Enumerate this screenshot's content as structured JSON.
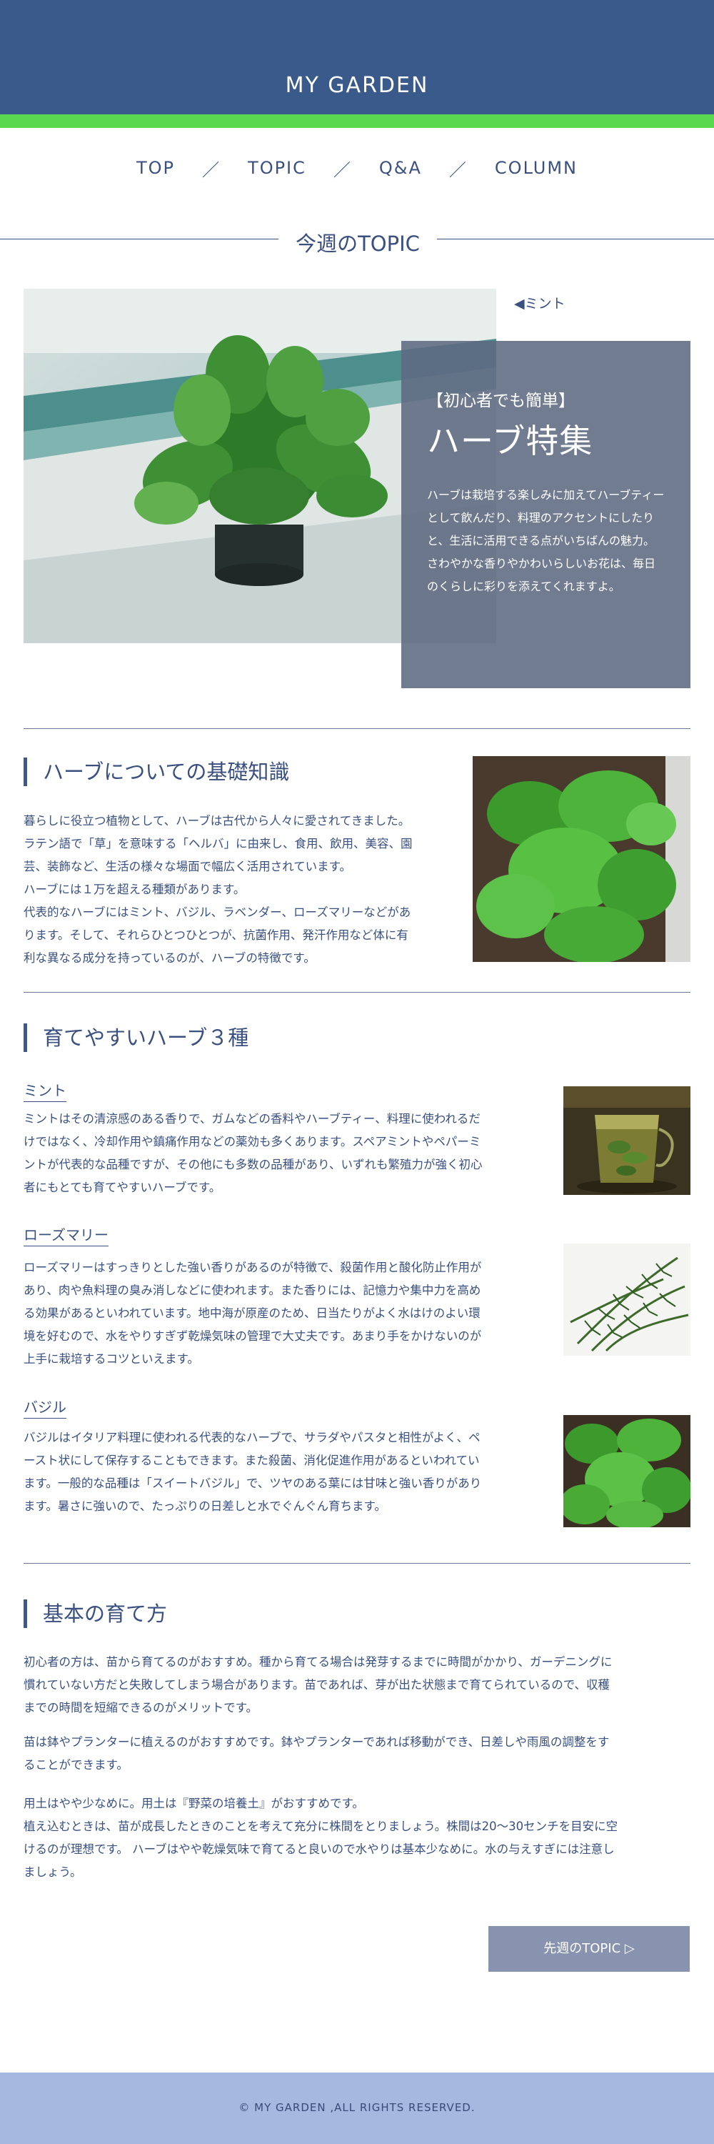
{
  "header": {
    "site_title": "MY GARDEN"
  },
  "nav": {
    "items": [
      {
        "label": "TOP"
      },
      {
        "label": "TOPIC"
      },
      {
        "label": "Q&A"
      },
      {
        "label": "COLUMN"
      }
    ],
    "separator": "／"
  },
  "week": {
    "heading": "今週のTOPIC"
  },
  "hero": {
    "caption": "◀ミント",
    "subtitle": "【初心者でも簡単】",
    "title": "ハーブ特集",
    "body": "ハーブは栽培する楽しみに加えてハーブティーとして飲んだり、料理のアクセントにしたりと、生活に活用できる点がいちばんの魅力。さわやかな香りやかわいらしいお花は、毎日のくらしに彩りを添えてくれますよ。"
  },
  "basics": {
    "title": "ハーブについての基礎知識",
    "lines": [
      "暮らしに役立つ植物として、ハーブは古代から人々に愛されてきました。",
      "ラテン語で「草」を意味する「ヘルバ」に由来し、食用、飲用、美容、園",
      "芸、装飾など、生活の様々な場面で幅広く活用されています。",
      "ハーブには１万を超える種類があります。",
      "代表的なハーブにはミント、バジル、ラベンダー、ローズマリーなどがあ",
      "ります。そして、それらひとつひとつが、抗菌作用、発汗作用など体に有",
      "利な異なる成分を持っているのが、ハーブの特徴です。"
    ]
  },
  "easy": {
    "title": "育てやすいハーブ３種",
    "herbs": [
      {
        "name": "ミント",
        "lines": [
          "ミントはその清涼感のある香りで、ガムなどの香料やハーブティー、料理に使われるだ",
          "けではなく、冷却作用や鎮痛作用などの薬効も多くあります。スペアミントやペパーミ",
          "ントが代表的な品種ですが、その他にも多数の品種があり、いずれも繁殖力が強く初心",
          "者にもとても育てやすいハーブです。"
        ]
      },
      {
        "name": "ローズマリー",
        "lines": [
          "ローズマリーはすっきりとした強い香りがあるのが特徴で、殺菌作用と酸化防止作用が",
          "あり、肉や魚料理の臭み消しなどに使われます。また香りには、記憶力や集中力を高め",
          "る効果があるといわれています。地中海が原産のため、日当たりがよく水はけのよい環",
          "境を好むので、水をやりすぎず乾燥気味の管理で大丈夫です。あまり手をかけないのが",
          "上手に栽培するコツといえます。"
        ]
      },
      {
        "name": "バジル",
        "lines": [
          "バジルはイタリア料理に使われる代表的なハーブで、サラダやパスタと相性がよく、ペ",
          "ースト状にして保存することもできます。また殺菌、消化促進作用があるといわれてい",
          "ます。一般的な品種は「スイートバジル」で、ツヤのある葉には甘味と強い香りがあり",
          "ます。暑さに強いので、たっぷりの日差しと水でぐんぐん育ちます。"
        ]
      }
    ]
  },
  "grow": {
    "title": "基本の育て方",
    "p1": [
      "初心者の方は、苗から育てるのがおすすめ。種から育てる場合は発芽するまでに時間がかかり、ガーデニングに",
      "慣れていない方だと失敗してしまう場合があります。苗であれば、芽が出た状態まで育てられているので、収穫",
      "までの時間を短縮できるのがメリットです。"
    ],
    "p2": [
      "苗は鉢やプランターに植えるのがおすすめです。鉢やプランターであれば移動ができ、日差しや雨風の調整をす",
      "ることができます。"
    ],
    "p3": [
      "用土はやや少なめに。用土は『野菜の培養土』がおすすめです。",
      "植え込むときは、苗が成長したときのことを考えて充分に株間をとりましょう。株間は20～30センチを目安に空",
      "けるのが理想です。 ハーブはやや乾燥気味で育てると良いので水やりは基本少なめに。水の与えすぎには注意し",
      "ましょう。"
    ]
  },
  "next_button": {
    "label": "先週のTOPIC ▷"
  },
  "footer": {
    "copyright": "© MY GARDEN ,ALL RIGHTS RESERVED."
  }
}
